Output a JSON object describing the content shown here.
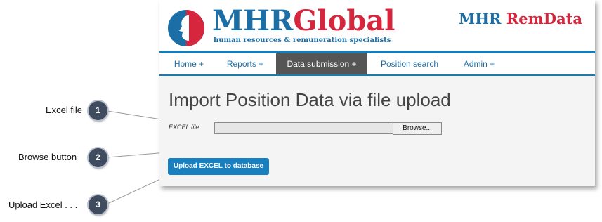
{
  "header": {
    "brand_part1": "MHR",
    "brand_part2": "Global",
    "tagline": "human resources & remuneration specialists",
    "product_part1": "MHR",
    "product_part2": "RemData"
  },
  "nav": {
    "items": [
      {
        "label": "Home +"
      },
      {
        "label": "Reports +"
      },
      {
        "label": "Data submission +",
        "active": true
      },
      {
        "label": "Position search"
      },
      {
        "label": "Admin +"
      }
    ]
  },
  "main": {
    "title": "Import Position Data via file upload",
    "excel_label": "EXCEL file",
    "excel_value": "",
    "browse_label": "Browse...",
    "upload_label": "Upload EXCEL to database"
  },
  "callouts": [
    {
      "number": "1",
      "label": "Excel file"
    },
    {
      "number": "2",
      "label": "Browse button"
    },
    {
      "number": "3",
      "label": "Upload Excel . . ."
    }
  ],
  "colors": {
    "brand_blue": "#1c6fa6",
    "brand_red": "#d6263d",
    "nav_active_bg": "#555555",
    "upload_button_bg": "#1a7fbf",
    "callout_badge": "#3f4b5e"
  }
}
